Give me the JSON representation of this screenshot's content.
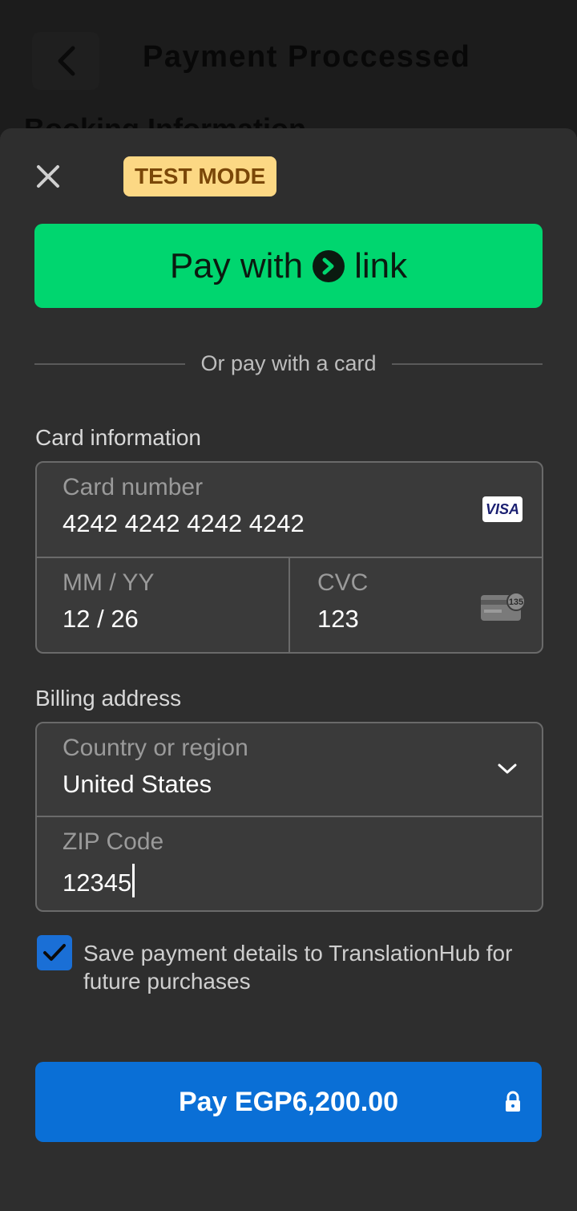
{
  "background": {
    "title": "Payment Proccessed",
    "peek_text": "Booking Information"
  },
  "sheet": {
    "test_badge": "TEST MODE",
    "link_button": {
      "prefix": "Pay with",
      "brand": "link"
    },
    "divider_text": "Or pay with a card",
    "card_section": {
      "label": "Card information",
      "card_number": {
        "label": "Card number",
        "value": "4242 4242 4242 4242",
        "brand_icon": "visa-icon",
        "brand_text": "VISA"
      },
      "expiry": {
        "label": "MM / YY",
        "value": "12 / 26"
      },
      "cvc": {
        "label": "CVC",
        "value": "123",
        "icon": "cvc-card-icon",
        "icon_text": "135"
      }
    },
    "billing_section": {
      "label": "Billing address",
      "country": {
        "label": "Country or region",
        "value": "United States"
      },
      "zip": {
        "label": "ZIP Code",
        "value": "12345"
      }
    },
    "save_details": {
      "checked": true,
      "text": "Save payment details to TranslationHub for future purchases"
    },
    "pay_button": {
      "label": "Pay EGP6,200.00",
      "icon": "lock-icon"
    }
  },
  "colors": {
    "link_green": "#00d66f",
    "pay_blue": "#0a6fd6",
    "test_badge_bg": "#fcd884",
    "sheet_bg": "#2e2e2e"
  }
}
